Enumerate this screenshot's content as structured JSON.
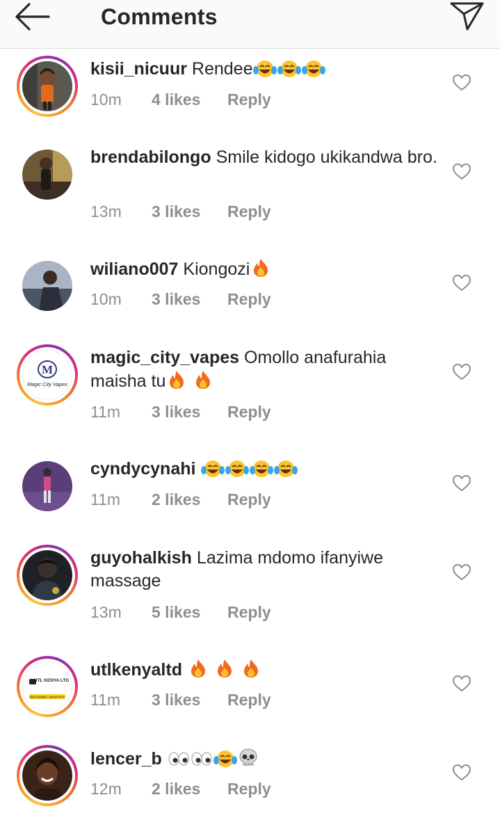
{
  "header": {
    "title": "Comments",
    "back_icon": "arrow-left-icon",
    "send_icon": "paper-plane-icon"
  },
  "comments": [
    {
      "username": "kisii_nicuur",
      "text": "Rendee",
      "emojis": [
        "laughing-tears",
        "laughing-tears",
        "laughing-tears"
      ],
      "time": "10m",
      "likes": "4 likes",
      "reply": "Reply",
      "story_ring": true,
      "avatar": "cartoon-figure"
    },
    {
      "username": "brendabilongo",
      "text": "Smile kidogo ukikandwa bro.",
      "emojis": [],
      "time": "13m",
      "likes": "3 likes",
      "reply": "Reply",
      "story_ring": false,
      "avatar": "person-indoors"
    },
    {
      "username": "wiliano007",
      "text": "Kiongozi",
      "emojis": [
        "fire"
      ],
      "time": "10m",
      "likes": "3 likes",
      "reply": "Reply",
      "story_ring": false,
      "avatar": "person-selfie"
    },
    {
      "username": "magic_city_vapes",
      "text": "Omollo anafurahia maisha tu",
      "emojis": [
        "fire",
        "fire"
      ],
      "time": "11m",
      "likes": "3 likes",
      "reply": "Reply",
      "story_ring": true,
      "avatar": "logo-m",
      "avatar_logo_letter": "M",
      "avatar_logo_text": "Magic City Vapes"
    },
    {
      "username": "cyndycynahi",
      "text": "",
      "emojis": [
        "laughing-tears",
        "laughing-tears",
        "laughing-tears",
        "laughing-tears"
      ],
      "time": "11m",
      "likes": "2 likes",
      "reply": "Reply",
      "story_ring": false,
      "avatar": "person-purple"
    },
    {
      "username": "guyohalkish",
      "text": "Lazima mdomo ifanyiwe massage",
      "emojis": [],
      "time": "13m",
      "likes": "5 likes",
      "reply": "Reply",
      "story_ring": true,
      "avatar": "person-dark"
    },
    {
      "username": "utlkenyaltd",
      "text": "",
      "emojis": [
        "fire",
        "fire",
        "fire"
      ],
      "time": "11m",
      "likes": "3 likes",
      "reply": "Reply",
      "story_ring": true,
      "avatar": "logo-utl",
      "avatar_logo_text": "UTL KENYA LTD",
      "avatar_logo_tagline": "Best Quality, Lowest Price"
    },
    {
      "username": "lencer_b",
      "text": "",
      "emojis": [
        "eyes",
        "eyes",
        "laughing-tears",
        "skull"
      ],
      "time": "12m",
      "likes": "2 likes",
      "reply": "Reply",
      "story_ring": true,
      "avatar": "person-smiling"
    }
  ],
  "colors": {
    "text": "#262626",
    "meta": "#8e8e8e",
    "divider": "#dbdbdb",
    "topbar_bg": "#fafafa",
    "ring": [
      "#f9c33a",
      "#f58529",
      "#dd2a7b",
      "#8134af"
    ]
  }
}
